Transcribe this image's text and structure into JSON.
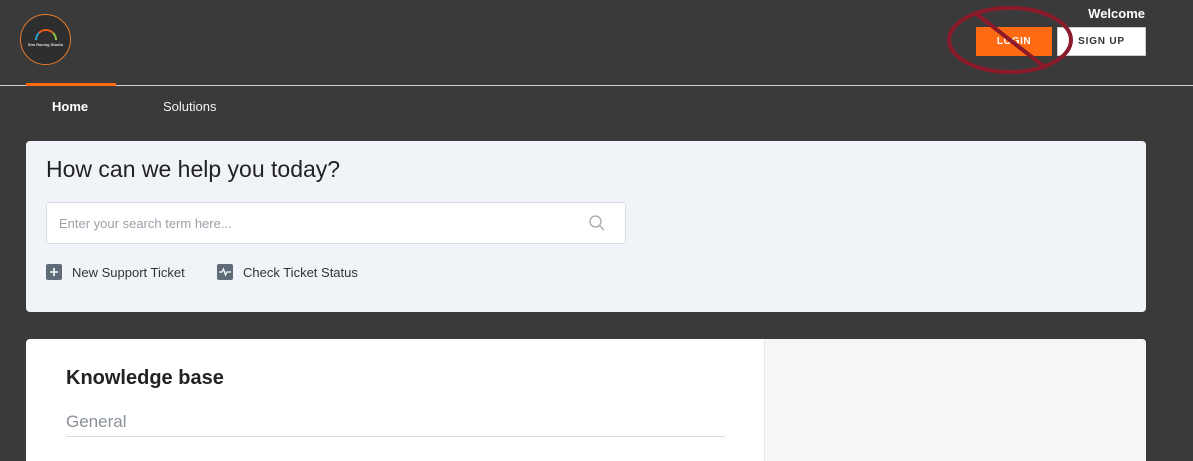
{
  "header": {
    "logo_text": "Sim Racing Studio",
    "welcome": "Welcome",
    "login_label": "LOGIN",
    "signup_label": "SIGN UP"
  },
  "nav": {
    "items": [
      {
        "label": "Home",
        "active": true
      },
      {
        "label": "Solutions",
        "active": false
      }
    ]
  },
  "help": {
    "title": "How can we help you today?",
    "search_placeholder": "Enter your search term here...",
    "search_value": "",
    "actions": [
      {
        "label": "New Support Ticket",
        "icon": "plus-icon"
      },
      {
        "label": "Check Ticket Status",
        "icon": "activity-icon"
      }
    ]
  },
  "knowledge_base": {
    "title": "Knowledge base",
    "sections": [
      "General"
    ]
  },
  "colors": {
    "accent": "#ff6a13",
    "background": "#3a3a3a",
    "annotation": "#8b1a2b"
  }
}
